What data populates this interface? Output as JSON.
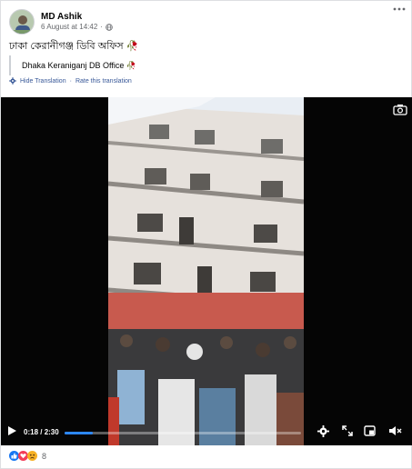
{
  "post": {
    "author": "MD Ashik",
    "date": "6 August at 14:42",
    "date_separator": "·",
    "audience_icon": "globe-icon",
    "more_icon": "more-options-icon",
    "text": "ঢাকা কেরানীগঞ্জ ডিবি অফিস",
    "text_emoji": "🥀"
  },
  "translation": {
    "text": "Dhaka Keraniganj DB Office",
    "text_emoji": "🥀",
    "hide_label": "Hide Translation",
    "separator": "·",
    "rate_label": "Rate this translation",
    "settings_icon": "gear-icon"
  },
  "video": {
    "current_time": "0:18",
    "time_separator": " / ",
    "duration": "2:30",
    "progress_fraction": 0.12,
    "accent": "#2d88ff",
    "icons": [
      "camera-icon",
      "play-icon",
      "settings-gear-icon",
      "expand-icon",
      "picture-in-picture-icon",
      "volume-muted-icon"
    ]
  },
  "reactions": {
    "icons": [
      "like-icon",
      "love-icon",
      "sad-icon"
    ],
    "count": "8"
  }
}
